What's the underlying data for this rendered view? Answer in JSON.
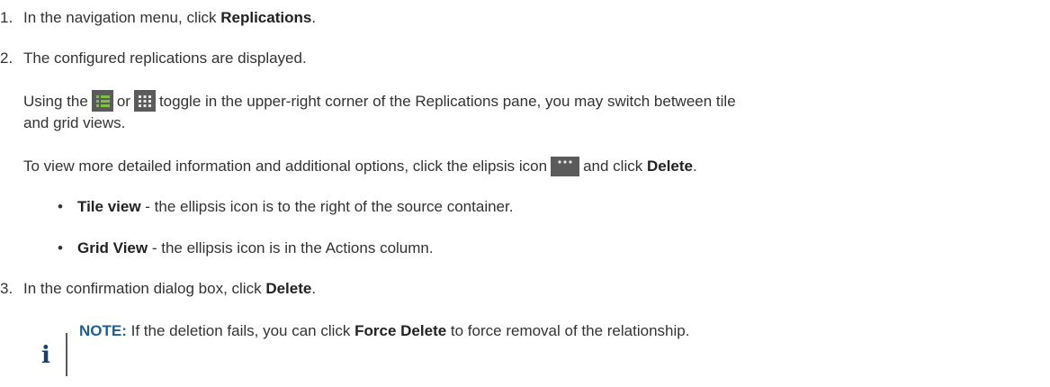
{
  "steps": [
    {
      "number": "1.",
      "before": "In the navigation menu, click ",
      "bold": "Replications",
      "after": "."
    },
    {
      "number": "2.",
      "text": "The configured replications are displayed.",
      "para1": {
        "a": "Using the",
        "b": "or",
        "c": "toggle in the upper-right corner of the Replications pane, you may switch between tile",
        "d": "and grid views."
      },
      "para2": {
        "a": "To view more detailed information and additional options, click the elipsis icon",
        "b": "and click ",
        "bold": "Delete",
        "c": "."
      },
      "bullets": [
        {
          "bold": "Tile view",
          "text": " - the ellipsis icon is to the right of the source container."
        },
        {
          "bold": "Grid View",
          "text": " - the ellipsis icon is in the Actions column."
        }
      ]
    },
    {
      "number": "3.",
      "before": "In the confirmation dialog box, click ",
      "bold": "Delete",
      "after": "."
    }
  ],
  "note": {
    "label": "NOTE:",
    "before": " If the deletion fails, you can click ",
    "bold": "Force Delete",
    "after": " to force removal of the relationship."
  },
  "icons": {
    "list_view": "list-view-icon",
    "grid_view": "grid-view-icon",
    "ellipsis": "ellipsis-icon",
    "note": "info-icon"
  },
  "colors": {
    "text": "#333333",
    "icon_bg": "#5b5b5b",
    "icon_accent": "#7fc241",
    "note_label": "#1f5f8f"
  }
}
